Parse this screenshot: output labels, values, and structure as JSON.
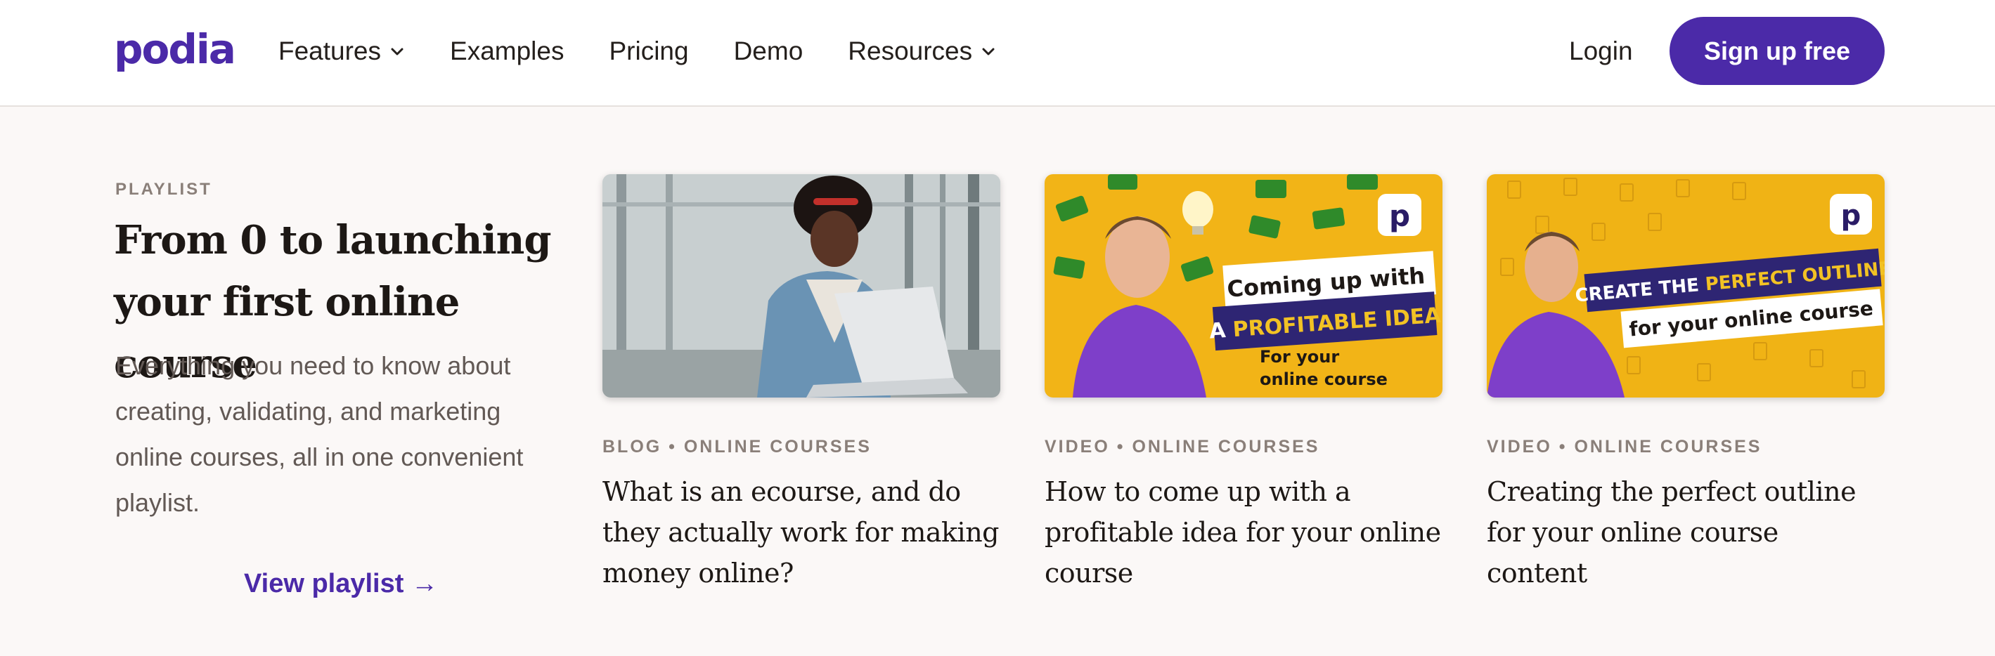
{
  "brand": {
    "logo_text": "podia",
    "accent_color": "#4b2aa8"
  },
  "nav": {
    "items": [
      {
        "label": "Features",
        "has_dropdown": true
      },
      {
        "label": "Examples",
        "has_dropdown": false
      },
      {
        "label": "Pricing",
        "has_dropdown": false
      },
      {
        "label": "Demo",
        "has_dropdown": false
      },
      {
        "label": "Resources",
        "has_dropdown": true
      }
    ],
    "login_label": "Login",
    "signup_label": "Sign up free"
  },
  "playlist": {
    "eyebrow": "PLAYLIST",
    "title": "From 0 to launching your first online course",
    "description": "Everything you need to know about creating, validating, and marketing online courses, all in one convenient playlist.",
    "link_label": "View playlist →"
  },
  "cards": [
    {
      "tag": "BLOG • ONLINE COURSES",
      "title": "What is an ecourse, and do they actually work for making money online?"
    },
    {
      "tag": "VIDEO • ONLINE COURSES",
      "title": "How to come up with a profitable idea for your online course",
      "thumb_text": {
        "line1": "Coming up with",
        "line2_prefix": "A ",
        "line2_highlight": "PROFITABLE IDEA",
        "line3": "For your",
        "line4": "online course"
      }
    },
    {
      "tag": "VIDEO • ONLINE COURSES",
      "title": "Creating the perfect outline for your online course content",
      "thumb_text": {
        "line1_prefix": "CREATE THE ",
        "line1_highlight": "PERFECT OUTLINE",
        "line2": "for your online course"
      }
    }
  ],
  "thumb_badge_letter": "p"
}
